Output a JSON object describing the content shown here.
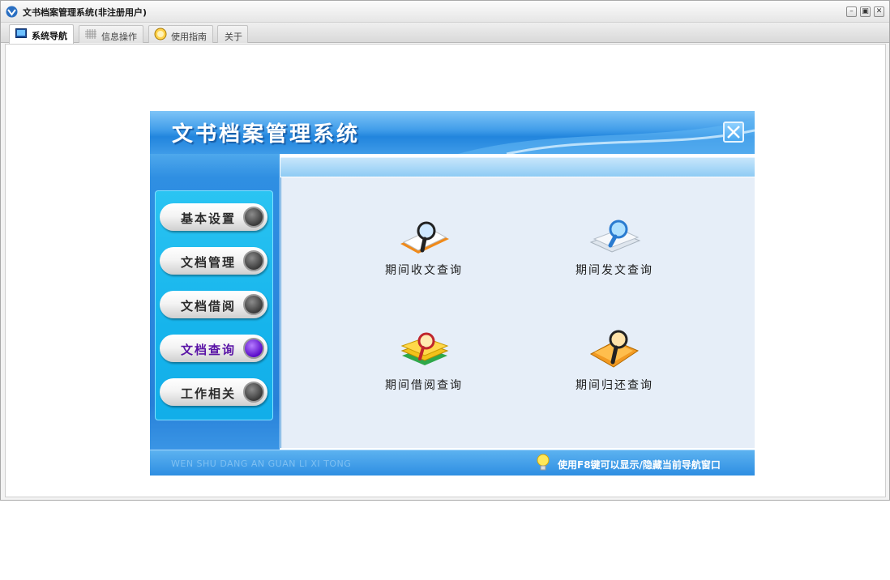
{
  "window": {
    "title": "文书档案管理系统(非注册用户)",
    "controls": {
      "minimize": "–",
      "restore": "▣",
      "close": "✕"
    }
  },
  "tabs": [
    {
      "label": "系统导航",
      "icon": "monitor-icon",
      "active": true
    },
    {
      "label": "信息操作",
      "icon": "grid-icon",
      "active": false
    },
    {
      "label": "使用指南",
      "icon": "help-circle-icon",
      "active": false
    },
    {
      "label": "关于",
      "icon": "",
      "active": false
    }
  ],
  "panel": {
    "title": "文书档案管理系统",
    "close_icon": "close-x-icon",
    "menu": [
      {
        "label": "基本设置",
        "active": false
      },
      {
        "label": "文档管理",
        "active": false
      },
      {
        "label": "文档借阅",
        "active": false
      },
      {
        "label": "文档查询",
        "active": true
      },
      {
        "label": "工作相关",
        "active": false
      }
    ],
    "queries": [
      {
        "label": "期间收文查询",
        "icon": "magnifier-document-icon"
      },
      {
        "label": "期间发文查询",
        "icon": "magnifier-papers-icon"
      },
      {
        "label": "期间借阅查询",
        "icon": "magnifier-books-icon"
      },
      {
        "label": "期间归还查询",
        "icon": "magnifier-folder-icon"
      }
    ],
    "footer": {
      "pinyin": "WEN SHU DANG AN GUAN LI XI TONG",
      "tip": "使用F8键可以显示/隐藏当前导航窗口",
      "tip_icon": "lightbulb-icon"
    }
  },
  "colors": {
    "accent_blue": "#2285dd",
    "menu_blue": "#16b4ec",
    "active_purple": "#5a14a6"
  }
}
